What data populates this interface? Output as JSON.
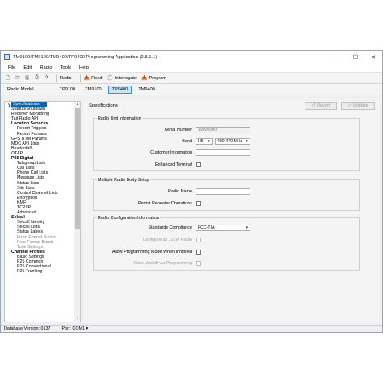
{
  "window": {
    "title": "TM9100/TM9100/TM9400/TP9400 Programming Application (2.8.1.1)",
    "controls": {
      "minimize": "—",
      "maximize": "☐",
      "close": "✕"
    }
  },
  "menu": [
    "File",
    "Edit",
    "Radio",
    "Tools",
    "Help"
  ],
  "toolbar": {
    "icons": [
      "new-file-icon",
      "open-folder-icon",
      "save-icon",
      "print-icon",
      "help-icon"
    ],
    "radio_label": "Radio",
    "read_label": "Read",
    "interrogate_label": "Interrogate",
    "program_label": "Program"
  },
  "model_bar": {
    "label": "Radio Model",
    "models": [
      "TP9100",
      "TM9100",
      "TP9400",
      "TM9400"
    ],
    "selected": "TP9400"
  },
  "tree": [
    {
      "label": "Specifications",
      "kind": "sel"
    },
    {
      "label": "Startup/Shutdown",
      "kind": "i1"
    },
    {
      "label": "Receiver Monitoring",
      "kind": "i1"
    },
    {
      "label": "Tait Radio API",
      "kind": "i1"
    },
    {
      "label": "Location Services",
      "kind": "cat i1"
    },
    {
      "label": "Report Triggers",
      "kind": "i2"
    },
    {
      "label": "Report Formats",
      "kind": "i2"
    },
    {
      "label": "GPS UTM Params",
      "kind": "i1"
    },
    {
      "label": "MDC ANI Lists",
      "kind": "i1"
    },
    {
      "label": "Bluetooth®",
      "kind": "i1"
    },
    {
      "label": "OTAP",
      "kind": "i1"
    },
    {
      "label": "P25 Digital",
      "kind": "cat i1"
    },
    {
      "label": "Talkgroup Lists",
      "kind": "i2"
    },
    {
      "label": "Call Lists",
      "kind": "i2"
    },
    {
      "label": "Phone Call Lists",
      "kind": "i2"
    },
    {
      "label": "Message Lists",
      "kind": "i2"
    },
    {
      "label": "Status Lists",
      "kind": "i2"
    },
    {
      "label": "Site Lists",
      "kind": "i2"
    },
    {
      "label": "Control Channel Lists",
      "kind": "i2"
    },
    {
      "label": "Encryption",
      "kind": "i2"
    },
    {
      "label": "KMF",
      "kind": "i2"
    },
    {
      "label": "TCP/IP",
      "kind": "i2"
    },
    {
      "label": "Advanced",
      "kind": "i2"
    },
    {
      "label": "Selcall",
      "kind": "cat i1"
    },
    {
      "label": "Selcall Identity",
      "kind": "i2"
    },
    {
      "label": "Selcall Lists",
      "kind": "i2"
    },
    {
      "label": "Status Labels",
      "kind": "i2"
    },
    {
      "label": "Fixed Format Bursts",
      "kind": "i2 dim"
    },
    {
      "label": "Free Format Bursts",
      "kind": "i2 dim"
    },
    {
      "label": "Tone Settings",
      "kind": "i2 dim"
    },
    {
      "label": "Channel Profiles",
      "kind": "cat i1"
    },
    {
      "label": "Basic Settings",
      "kind": "i2"
    },
    {
      "label": "P25 Common",
      "kind": "i2"
    },
    {
      "label": "P25 Conventional",
      "kind": "i2"
    },
    {
      "label": "P25 Trunking",
      "kind": "i2"
    }
  ],
  "specifications": {
    "title": "Specifications",
    "revert_label": "Revert",
    "validate_label": "Validate",
    "radio_unit": {
      "title": "Radio Unit Information",
      "serial_label": "Serial Number",
      "serial_value": "19000000",
      "band_label": "Band",
      "band_value": "H5",
      "band_range": "400-470 MHz",
      "customer_label": "Customer Information",
      "customer_value": "",
      "enhanced_label": "Enhanced Terminal"
    },
    "multi_body": {
      "title": "Multiple Radio Body Setup",
      "radio_name_label": "Radio Name",
      "radio_name_value": "",
      "permit_label": "Permit Repeater Operations"
    },
    "config": {
      "title": "Radio Configuration Information",
      "compliance_label": "Standards Compliance",
      "compliance_value": "FCC-TIA",
      "configure_label": "Configure as 110W Radio",
      "allow_inhibited_label": "Allow Programming Mode When Inhibited",
      "allow_unshift_label": "Allow Unshift via Programming"
    }
  },
  "status": {
    "db_version": "Database Version: 0137",
    "port": "Port: COM1 ▾"
  }
}
